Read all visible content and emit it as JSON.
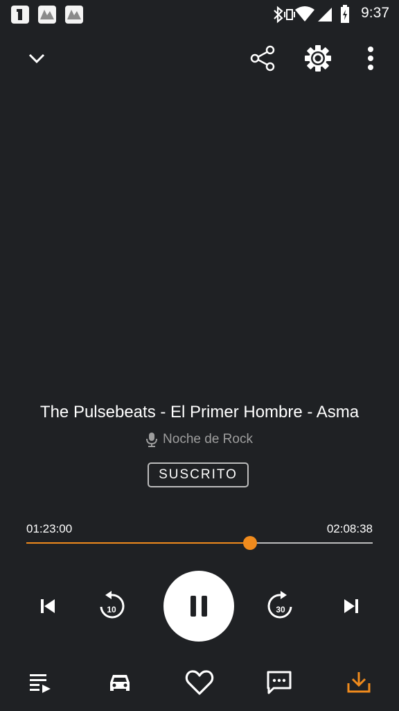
{
  "status_bar": {
    "time": "9:37",
    "icons": [
      "notification-app-icon",
      "notification-image-icon",
      "notification-image-icon",
      "bluetooth-icon",
      "vibrate-icon",
      "wifi-icon",
      "cell-signal-icon",
      "battery-charging-icon"
    ]
  },
  "toolbar": {
    "icons": [
      "chevron-down-icon",
      "share-icon",
      "gear-icon",
      "more-vert-icon"
    ]
  },
  "episode": {
    "title": "The Pulsebeats - El Primer Hombre - Asma",
    "podcast": "Noche de Rock",
    "subscribe_label": "SUSCRITO"
  },
  "progress": {
    "elapsed": "01:23:00",
    "total": "02:08:38",
    "fraction": 0.646
  },
  "controls": {
    "rewind_seconds": "10",
    "forward_seconds": "30"
  },
  "bottom_bar": {
    "icons": [
      "queue-icon",
      "car-icon",
      "heart-icon",
      "comments-icon",
      "download-icon"
    ]
  },
  "colors": {
    "background": "#1f2124",
    "accent": "#f08b1d",
    "secondary_text": "#9e9e9e"
  }
}
